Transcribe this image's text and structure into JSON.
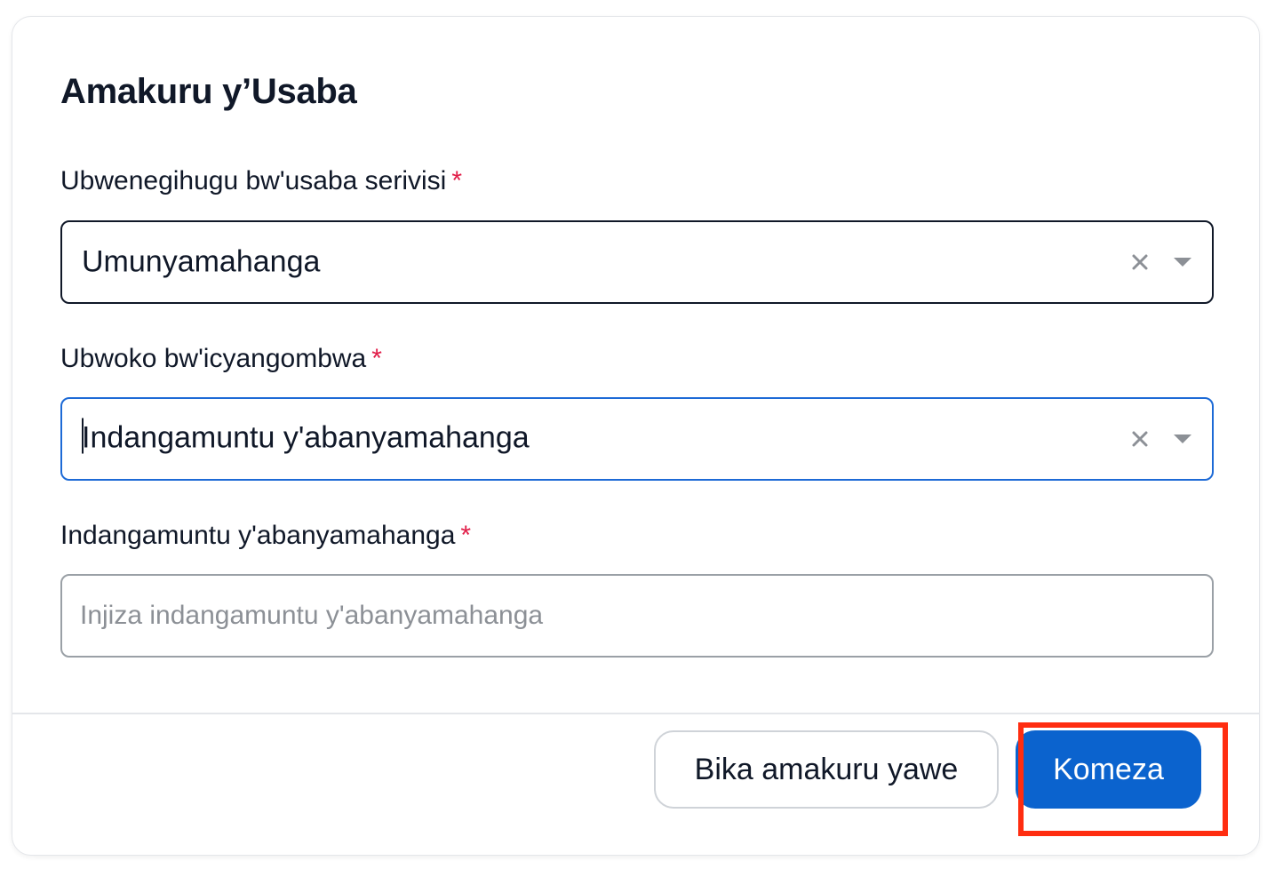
{
  "form": {
    "title": "Amakuru y’Usaba",
    "required_marker": "*",
    "nationality": {
      "label": "Ubwenegihugu bw'usaba serivisi",
      "value": "Umunyamahanga"
    },
    "document_type": {
      "label": "Ubwoko bw'icyangombwa",
      "value": "Indangamuntu y'abanyamahanga"
    },
    "foreign_id": {
      "label": "Indangamuntu y'abanyamahanga",
      "value": "",
      "placeholder": "Injiza indangamuntu y'abanyamahanga"
    }
  },
  "footer": {
    "save_label": "Bika amakuru yawe",
    "continue_label": "Komeza"
  },
  "icons": {
    "clear": "close-icon",
    "dropdown": "chevron-down-icon"
  },
  "colors": {
    "primary": "#0b63ce",
    "focus_border": "#1d6ad6",
    "required": "#e11d48",
    "highlight": "#ff2d10",
    "text": "#101828"
  }
}
